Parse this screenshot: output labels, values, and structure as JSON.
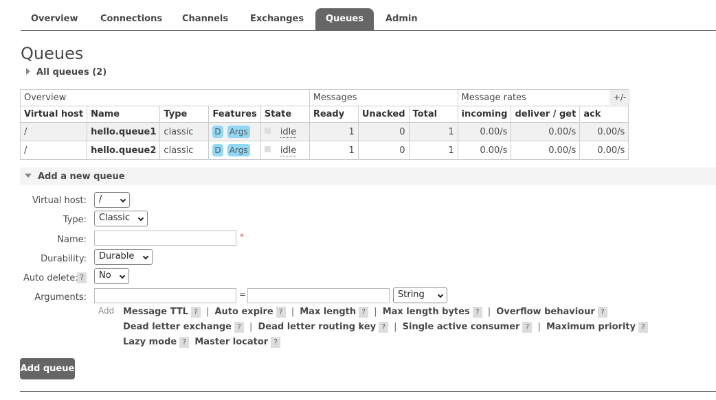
{
  "nav": {
    "tabs": [
      {
        "label": "Overview"
      },
      {
        "label": "Connections"
      },
      {
        "label": "Channels"
      },
      {
        "label": "Exchanges"
      },
      {
        "label": "Queues",
        "active": true
      },
      {
        "label": "Admin"
      }
    ]
  },
  "page": {
    "title": "Queues",
    "all_queues_label": "All queues (2)"
  },
  "table": {
    "groups": [
      "Overview",
      "Messages",
      "Message rates"
    ],
    "columns": [
      "Virtual host",
      "Name",
      "Type",
      "Features",
      "State",
      "Ready",
      "Unacked",
      "Total",
      "incoming",
      "deliver / get",
      "ack"
    ],
    "plus_minus": "+/-",
    "rows": [
      {
        "vhost": "/",
        "name": "hello.queue1",
        "type": "classic",
        "features": [
          "D",
          "Args"
        ],
        "state": "idle",
        "ready": "1",
        "unacked": "0",
        "total": "1",
        "incoming": "0.00/s",
        "deliver_get": "0.00/s",
        "ack": "0.00/s"
      },
      {
        "vhost": "/",
        "name": "hello.queue2",
        "type": "classic",
        "features": [
          "D",
          "Args"
        ],
        "state": "idle",
        "ready": "1",
        "unacked": "0",
        "total": "1",
        "incoming": "0.00/s",
        "deliver_get": "0.00/s",
        "ack": "0.00/s"
      }
    ]
  },
  "add_queue": {
    "section_label": "Add a new queue",
    "labels": {
      "vhost": "Virtual host:",
      "type": "Type:",
      "name": "Name:",
      "durability": "Durability:",
      "auto_delete": "Auto delete:",
      "arguments": "Arguments:"
    },
    "values": {
      "vhost": "/",
      "type": "Classic",
      "name": "",
      "durability": "Durable",
      "auto_delete": "No",
      "arg_key": "",
      "arg_value": "",
      "arg_type": "String"
    },
    "required_mark": "*",
    "help_mark": "?",
    "equals": "=",
    "add_word": "Add",
    "arg_links_line1": [
      "Message TTL",
      "Auto expire",
      "Max length",
      "Max length bytes",
      "Overflow behaviour"
    ],
    "arg_links_line2": [
      "Dead letter exchange",
      "Dead letter routing key",
      "Single active consumer",
      "Maximum priority"
    ],
    "arg_links_line3": [
      "Lazy mode",
      "Master locator"
    ],
    "separator": "|",
    "submit_label": "Add queue"
  }
}
